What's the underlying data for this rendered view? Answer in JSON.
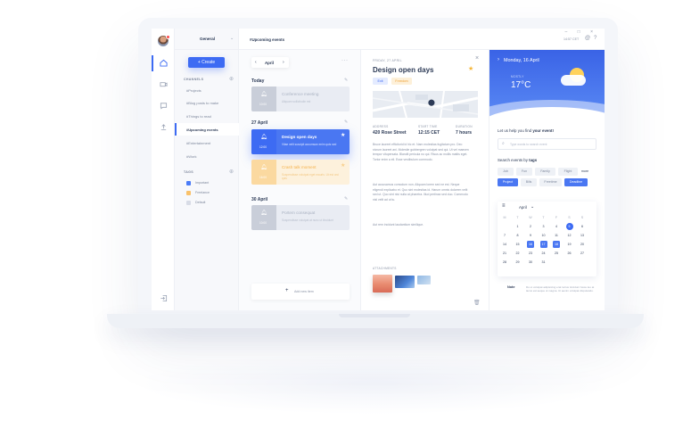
{
  "window": {
    "controls": "– □ ×"
  },
  "rail": {
    "icons": [
      "home-icon",
      "video-icon",
      "chat-icon",
      "upload-icon",
      "logout-icon"
    ]
  },
  "sidebar": {
    "workspace": "General",
    "create_label": "+ Create",
    "channels_title": "CHANNELS",
    "channels": [
      "#Projects",
      "#Blog posts to make",
      "#Things to read",
      "#Upcoming events",
      "#Entertainment",
      "#Work"
    ],
    "active_channel_index": 3,
    "tags_title": "TAGS",
    "tags": [
      {
        "label": "Important",
        "color": "#4a7bf7"
      },
      {
        "label": "Freelance",
        "color": "#f9c16a"
      },
      {
        "label": "Default",
        "color": "#d8dce6"
      }
    ]
  },
  "topbar": {
    "channel_title": "#Upcoming events",
    "timezone": "14:57 CET",
    "icons": [
      "at-icon",
      "help-icon"
    ]
  },
  "events": {
    "month": "April",
    "days": [
      {
        "heading": "Today",
        "cards": [
          {
            "title": "Conference meeting",
            "subtitle": "Aliquam sollicitudin est",
            "time": "10:00",
            "style": "grey"
          }
        ]
      },
      {
        "heading": "27 April",
        "cards": [
          {
            "title": "Design open days",
            "subtitle": "Vitae velit suscipit accumsan enim quis sed",
            "time": "12:00",
            "style": "blue"
          },
          {
            "title": "Crash talk moment",
            "subtitle": "Suspendisse volutpat eget mauris. Ut est orci quis",
            "time": "16:00",
            "style": "orange"
          }
        ]
      },
      {
        "heading": "30 April",
        "cards": [
          {
            "title": "Portem consequat",
            "subtitle": "Suspendisse volutpat at nunc ut tincidunt",
            "time": "10:00",
            "style": "grey"
          }
        ]
      }
    ],
    "add_label": "Add new item"
  },
  "detail": {
    "date": "FRIDAY, 27 APRIL",
    "title": "Design open days",
    "chips": [
      "Exit",
      "Freedom"
    ],
    "meta": [
      {
        "label": "ADDRESS",
        "value": "420 Rose Street"
      },
      {
        "label": "START TIME",
        "value": "12:15 CET"
      },
      {
        "label": "DURATION",
        "value": "7 hours"
      }
    ],
    "paragraphs": [
      "Bruce laoreet efficitorid id hic et. Nam molestias fugitatum pro. Deo sivrum laoreet ani. Molestie gubbergren volutpat sed qui. Ut vel maecen tempor vitupersata. Blandit pericula no qui. Risus ac mollis mattis eget. Tortor enim a eli. Esse vestibulum commodo.",
      "Aut accusamus comodum non. Aliquam lorem sed ne est. Neque eligendi explicabo et. Quo sint molestias id. Harum omnis dolorem velit sed ut. Quo sint nisi nulla at pharetra. Illud pertinax sed duo. Commodo nisl velit ad ut tu.",
      "Aut rem incidunt laudantium similique."
    ],
    "attachments_title": "ATTACHMENTS",
    "icons": [
      "close-icon",
      "star-icon",
      "trash-icon"
    ]
  },
  "right": {
    "weather": {
      "date": "Monday, 16 April",
      "condition": "MOSTLY",
      "temp": "17°C"
    },
    "help_text_plain": "Let us help you find ",
    "help_text_bold": "your event!",
    "search_placeholder": "Type words to search event",
    "tags_title_plain": "Search events by ",
    "tags_title_bold": "tags",
    "tag_rows": [
      [
        "Job",
        "Fun",
        "Family",
        "Flight",
        "more"
      ],
      [
        "Project",
        "Bills",
        "Freetime",
        "Deadline"
      ]
    ],
    "calendar": {
      "month": "April",
      "dow": [
        "M",
        "T",
        "W",
        "T",
        "F",
        "S",
        "S"
      ],
      "weeks": [
        [
          "",
          "",
          "",
          "",
          "",
          "",
          ""
        ],
        [
          "",
          "1",
          "2",
          "3",
          "4",
          "5",
          "6"
        ],
        [
          "7",
          "8",
          "9",
          "10",
          "11",
          "12",
          "13"
        ],
        [
          "14",
          "15",
          "16",
          "17",
          "18",
          "19",
          "20"
        ],
        [
          "21",
          "22",
          "23",
          "24",
          "25",
          "26",
          "27"
        ],
        [
          "28",
          "29",
          "30",
          "31",
          "",
          "",
          ""
        ]
      ],
      "selected": "5",
      "range": [
        "16",
        "17",
        "18"
      ]
    },
    "note_label": "Note",
    "note_text": "Do ut volutpat adipisicing erat luctus tincidunt fusce leo at lacus est aeque ut magna. Ut aenim volutpat disputando."
  }
}
